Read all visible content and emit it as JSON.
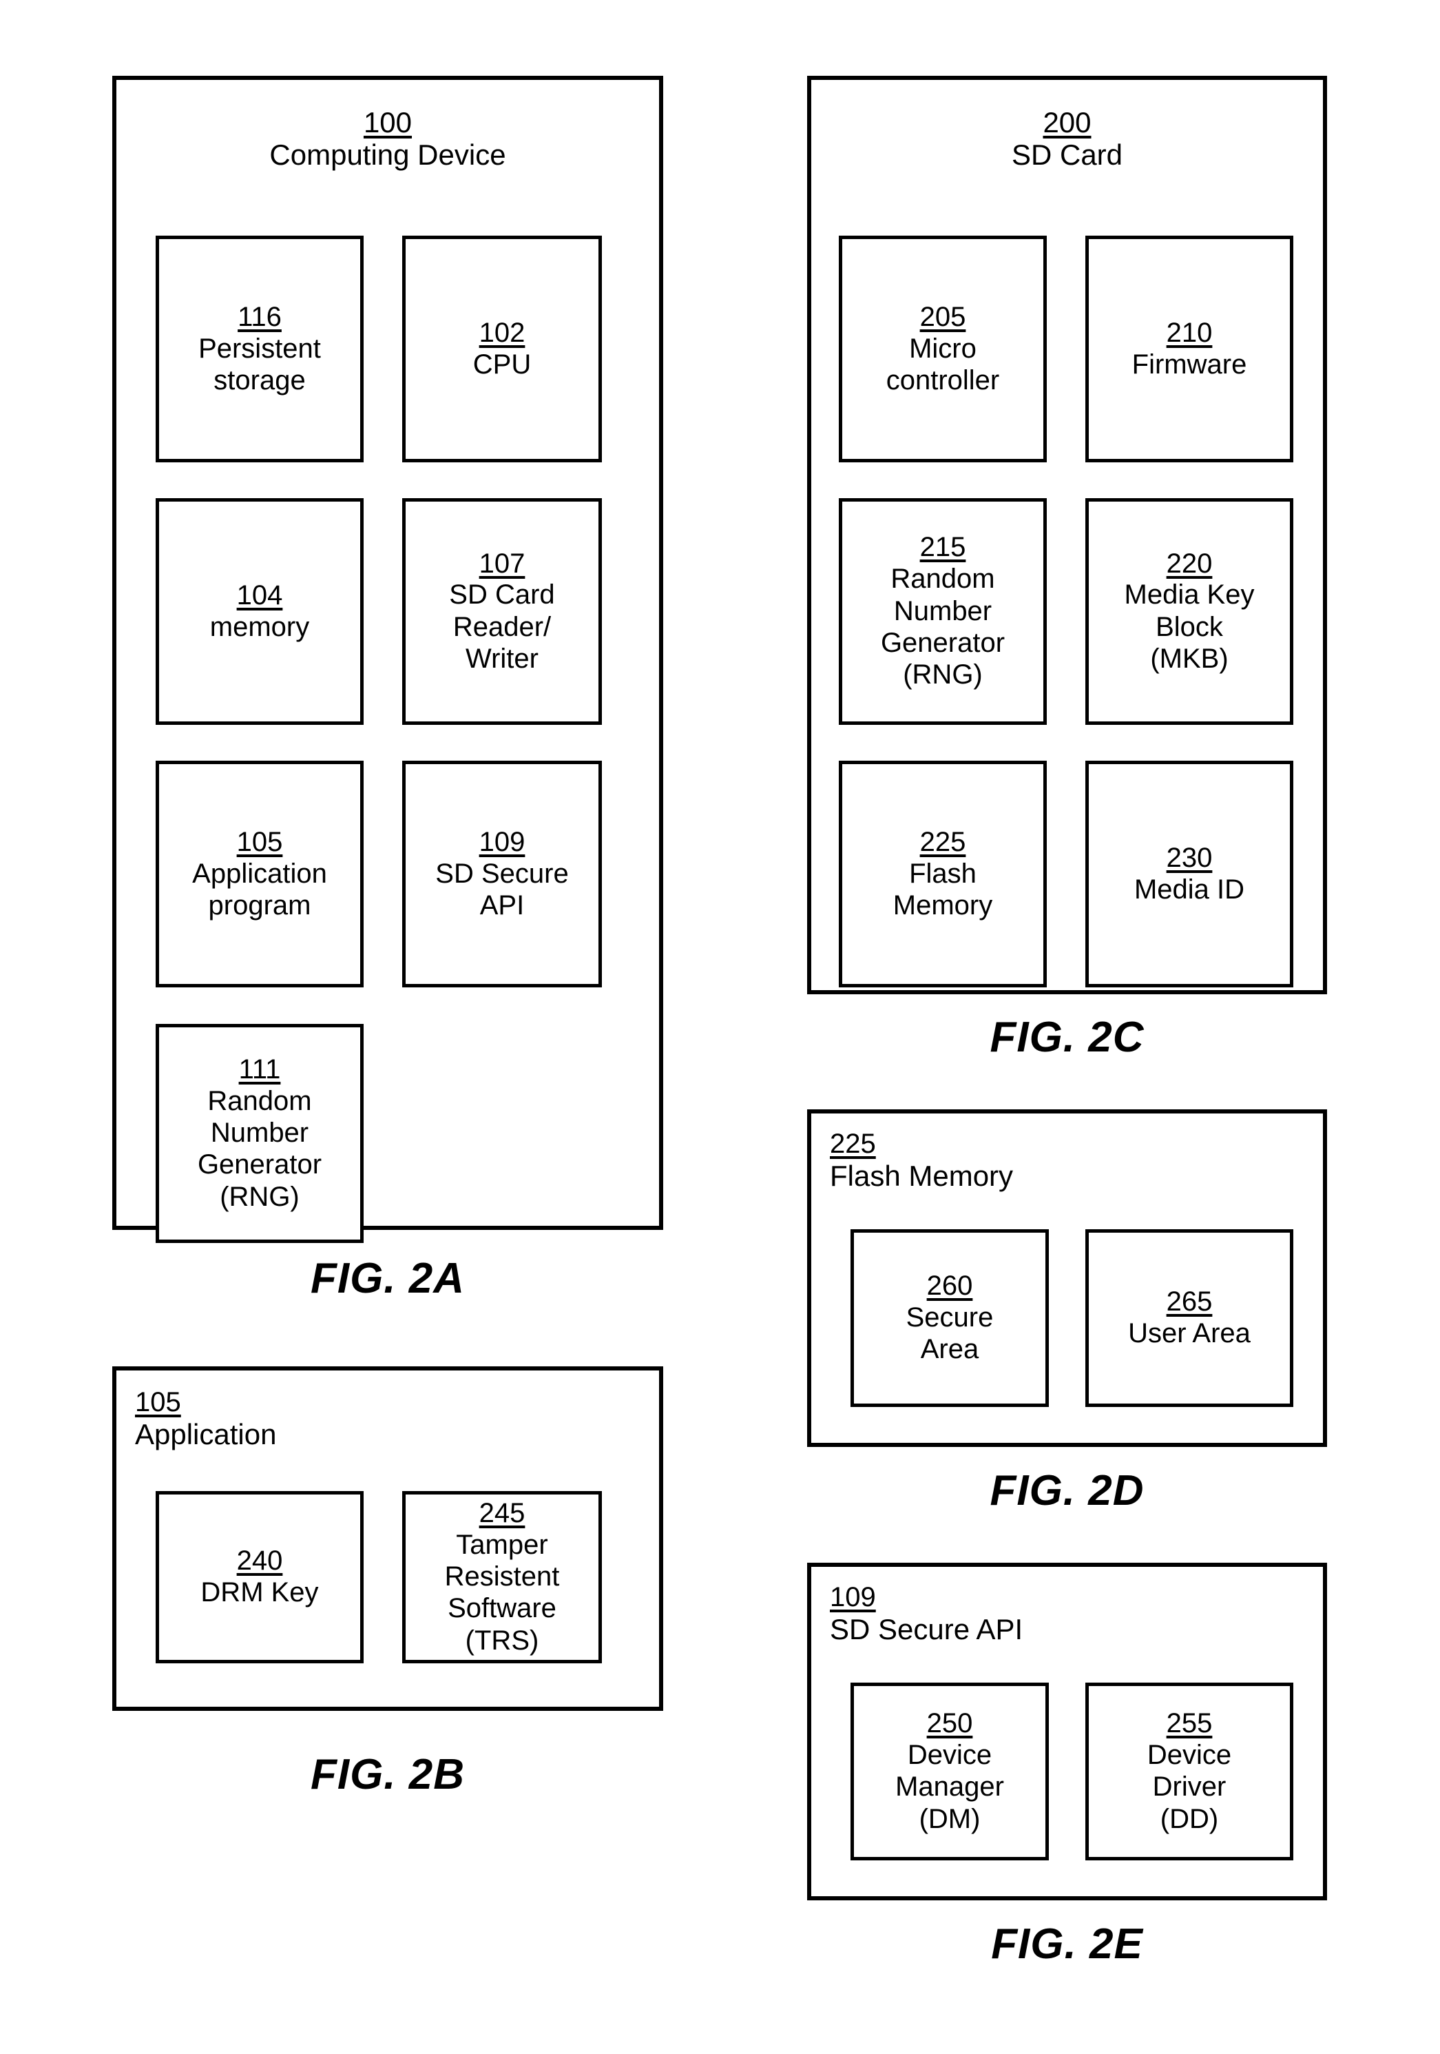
{
  "figures": [
    {
      "id": "fig-2a",
      "label": "FIG. 2A",
      "head": {
        "ref": "100",
        "caption": "Computing Device"
      },
      "boxes": [
        {
          "ref": "116",
          "caption": "Persistent\nstorage"
        },
        {
          "ref": "102",
          "caption": "CPU"
        },
        {
          "ref": "104",
          "caption": "memory"
        },
        {
          "ref": "107",
          "caption": "SD Card\nReader/\nWriter"
        },
        {
          "ref": "105",
          "caption": "Application\nprogram"
        },
        {
          "ref": "109",
          "caption": "SD Secure\nAPI"
        },
        {
          "ref": "111",
          "caption": "Random\nNumber\nGenerator\n(RNG)"
        }
      ]
    },
    {
      "id": "fig-2b",
      "label": "FIG. 2B",
      "head": {
        "ref": "105",
        "caption": "Application"
      },
      "boxes": [
        {
          "ref": "240",
          "caption": "DRM Key"
        },
        {
          "ref": "245",
          "caption": "Tamper\nResistent\nSoftware\n(TRS)"
        }
      ]
    },
    {
      "id": "fig-2c",
      "label": "FIG. 2C",
      "head": {
        "ref": "200",
        "caption": "SD Card"
      },
      "boxes": [
        {
          "ref": "205",
          "caption": "Micro\ncontroller"
        },
        {
          "ref": "210",
          "caption": "Firmware"
        },
        {
          "ref": "215",
          "caption": "Random\nNumber\nGenerator\n(RNG)"
        },
        {
          "ref": "220",
          "caption": "Media Key\nBlock\n(MKB)"
        },
        {
          "ref": "225",
          "caption": "Flash\nMemory"
        },
        {
          "ref": "230",
          "caption": "Media ID"
        }
      ]
    },
    {
      "id": "fig-2d",
      "label": "FIG. 2D",
      "head": {
        "ref": "225",
        "caption": "Flash Memory"
      },
      "boxes": [
        {
          "ref": "260",
          "caption": "Secure\nArea"
        },
        {
          "ref": "265",
          "caption": "User Area"
        }
      ]
    },
    {
      "id": "fig-2e",
      "label": "FIG. 2E",
      "head": {
        "ref": "109",
        "caption": "SD Secure API"
      },
      "boxes": [
        {
          "ref": "250",
          "caption": "Device\nManager\n(DM)"
        },
        {
          "ref": "255",
          "caption": "Device\nDriver\n(DD)"
        }
      ]
    }
  ]
}
